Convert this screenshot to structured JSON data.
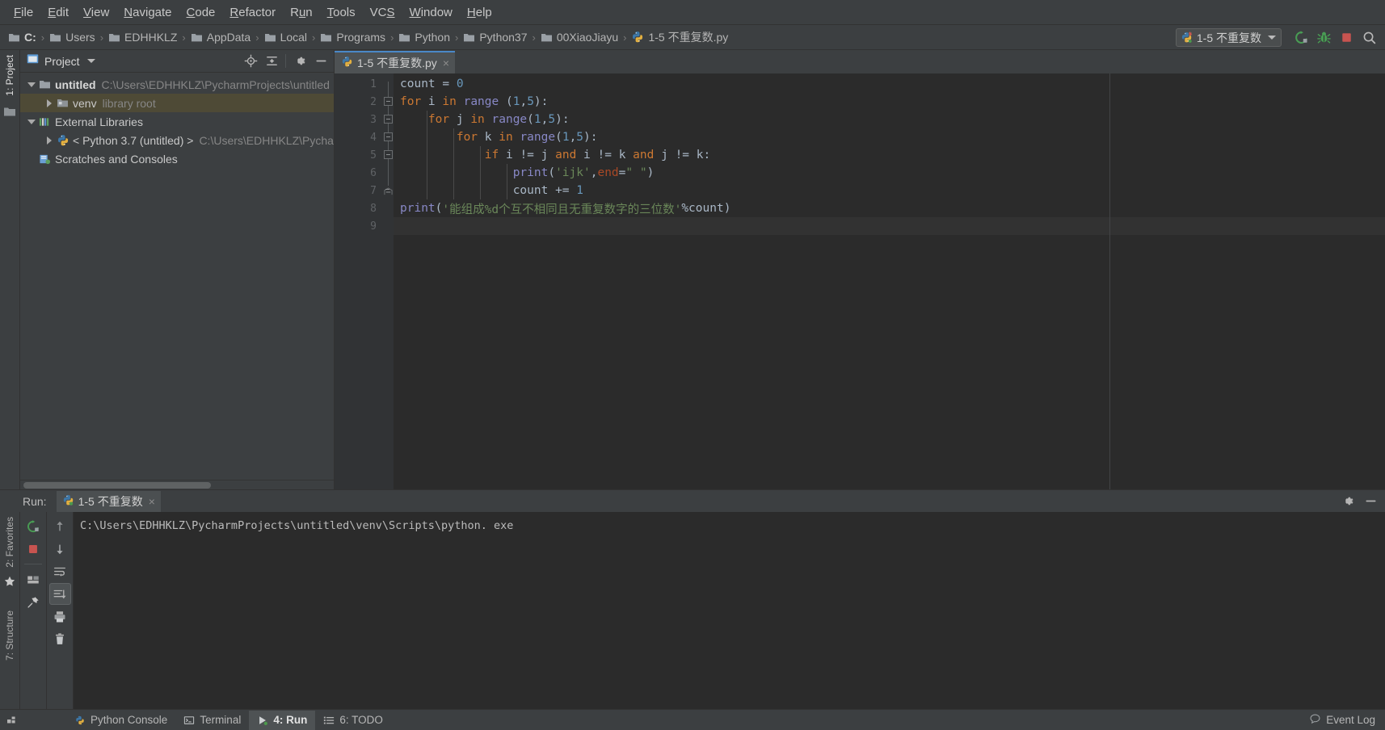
{
  "menu": {
    "items": [
      {
        "label": "File",
        "mnemonic": "F"
      },
      {
        "label": "Edit",
        "mnemonic": "E"
      },
      {
        "label": "View",
        "mnemonic": "V"
      },
      {
        "label": "Navigate",
        "mnemonic": "N"
      },
      {
        "label": "Code",
        "mnemonic": "C"
      },
      {
        "label": "Refactor",
        "mnemonic": "R"
      },
      {
        "label": "Run",
        "mnemonic": "u"
      },
      {
        "label": "Tools",
        "mnemonic": "T"
      },
      {
        "label": "VCS",
        "mnemonic": "S"
      },
      {
        "label": "Window",
        "mnemonic": "W"
      },
      {
        "label": "Help",
        "mnemonic": "H"
      }
    ]
  },
  "navbar": {
    "crumbs": [
      {
        "label": "C:",
        "icon": "folder-icon",
        "bold": true
      },
      {
        "label": "Users",
        "icon": "folder-icon",
        "bold": false
      },
      {
        "label": "EDHHKLZ",
        "icon": "folder-icon",
        "bold": false
      },
      {
        "label": "AppData",
        "icon": "folder-icon",
        "bold": false
      },
      {
        "label": "Local",
        "icon": "folder-icon",
        "bold": false
      },
      {
        "label": "Programs",
        "icon": "folder-icon",
        "bold": false
      },
      {
        "label": "Python",
        "icon": "folder-icon",
        "bold": false
      },
      {
        "label": "Python37",
        "icon": "folder-icon",
        "bold": false
      },
      {
        "label": "00XiaoJiayu",
        "icon": "folder-icon",
        "bold": false
      },
      {
        "label": "1-5 不重复数.py",
        "icon": "python-file-icon",
        "bold": false
      }
    ],
    "separator": "›",
    "run_config": "1-5 不重复数",
    "buttons": [
      {
        "name": "rerun-icon",
        "title": "Rerun"
      },
      {
        "name": "debug-icon",
        "title": "Debug"
      },
      {
        "name": "stop-icon",
        "title": "Stop"
      },
      {
        "name": "search-everywhere-icon",
        "title": "Search Everywhere"
      }
    ]
  },
  "left_strip": {
    "tabs": [
      {
        "label": "1: Project",
        "active": true
      }
    ],
    "bottom_tabs": [
      {
        "label": "2: Favorites",
        "active": false
      },
      {
        "label": "7: Structure",
        "active": false
      }
    ]
  },
  "project_panel": {
    "title": "Project",
    "header_icons": [
      "locate-icon",
      "collapse-all-icon",
      "settings-icon",
      "hide-icon"
    ],
    "tree": [
      {
        "label": "untitled",
        "sub": "C:\\Users\\EDHHKLZ\\PycharmProjects\\untitled",
        "indent": 0,
        "twisty": "down",
        "icon": "folder-icon",
        "bold": true,
        "selected": false
      },
      {
        "label": "venv",
        "sub": "library root",
        "indent": 1,
        "twisty": "right",
        "icon": "venv-folder-icon",
        "bold": false,
        "selected": true
      },
      {
        "label": "External Libraries",
        "sub": "",
        "indent": 0,
        "twisty": "down",
        "icon": "libraries-icon",
        "bold": false,
        "selected": false
      },
      {
        "label": "< Python 3.7 (untitled) >",
        "sub": "C:\\Users\\EDHHKLZ\\Pycharm",
        "indent": 1,
        "twisty": "right",
        "icon": "python-icon",
        "bold": false,
        "selected": false
      },
      {
        "label": "Scratches and Consoles",
        "sub": "",
        "indent": 0,
        "twisty": "none",
        "icon": "scratches-icon",
        "bold": false,
        "selected": false
      }
    ]
  },
  "editor": {
    "tabs": [
      {
        "label": "1-5 不重复数.py",
        "icon": "python-file-icon",
        "active": true,
        "close": "×"
      }
    ],
    "line_numbers": [
      "1",
      "2",
      "3",
      "4",
      "5",
      "6",
      "7",
      "8",
      "9"
    ],
    "code_lines": [
      {
        "num": 1,
        "tokens": [
          {
            "t": "count ",
            "c": "id"
          },
          {
            "t": "= ",
            "c": "par"
          },
          {
            "t": "0",
            "c": "num"
          }
        ],
        "indent": 0
      },
      {
        "num": 2,
        "tokens": [
          {
            "t": "for ",
            "c": "kw"
          },
          {
            "t": "i ",
            "c": "id"
          },
          {
            "t": "in ",
            "c": "kw"
          },
          {
            "t": "range ",
            "c": "bi"
          },
          {
            "t": "(",
            "c": "par"
          },
          {
            "t": "1",
            "c": "num"
          },
          {
            "t": ",",
            "c": "par"
          },
          {
            "t": "5",
            "c": "num"
          },
          {
            "t": "):",
            "c": "par"
          }
        ],
        "indent": 0
      },
      {
        "num": 3,
        "tokens": [
          {
            "t": "    ",
            "c": "id"
          },
          {
            "t": "for ",
            "c": "kw"
          },
          {
            "t": "j ",
            "c": "id"
          },
          {
            "t": "in ",
            "c": "kw"
          },
          {
            "t": "range",
            "c": "bi"
          },
          {
            "t": "(",
            "c": "par"
          },
          {
            "t": "1",
            "c": "num"
          },
          {
            "t": ",",
            "c": "par"
          },
          {
            "t": "5",
            "c": "num"
          },
          {
            "t": "):",
            "c": "par"
          }
        ],
        "indent": 1
      },
      {
        "num": 4,
        "tokens": [
          {
            "t": "        ",
            "c": "id"
          },
          {
            "t": "for ",
            "c": "kw"
          },
          {
            "t": "k ",
            "c": "id"
          },
          {
            "t": "in ",
            "c": "kw"
          },
          {
            "t": "range",
            "c": "bi"
          },
          {
            "t": "(",
            "c": "par"
          },
          {
            "t": "1",
            "c": "num"
          },
          {
            "t": ",",
            "c": "par"
          },
          {
            "t": "5",
            "c": "num"
          },
          {
            "t": "):",
            "c": "par"
          }
        ],
        "indent": 2
      },
      {
        "num": 5,
        "tokens": [
          {
            "t": "            ",
            "c": "id"
          },
          {
            "t": "if ",
            "c": "kw"
          },
          {
            "t": "i ",
            "c": "id"
          },
          {
            "t": "!= ",
            "c": "par"
          },
          {
            "t": "j ",
            "c": "id"
          },
          {
            "t": "and ",
            "c": "kw"
          },
          {
            "t": "i ",
            "c": "id"
          },
          {
            "t": "!= ",
            "c": "par"
          },
          {
            "t": "k ",
            "c": "id"
          },
          {
            "t": "and ",
            "c": "kw"
          },
          {
            "t": "j ",
            "c": "id"
          },
          {
            "t": "!= ",
            "c": "par"
          },
          {
            "t": "k:",
            "c": "id"
          }
        ],
        "indent": 3
      },
      {
        "num": 6,
        "tokens": [
          {
            "t": "                ",
            "c": "id"
          },
          {
            "t": "print",
            "c": "bi"
          },
          {
            "t": "(",
            "c": "par"
          },
          {
            "t": "'ijk'",
            "c": "str"
          },
          {
            "t": ",",
            "c": "par"
          },
          {
            "t": "end",
            "c": "kwarg"
          },
          {
            "t": "=",
            "c": "par"
          },
          {
            "t": "\" \"",
            "c": "str"
          },
          {
            "t": ")",
            "c": "par"
          }
        ],
        "indent": 4
      },
      {
        "num": 7,
        "tokens": [
          {
            "t": "                ",
            "c": "id"
          },
          {
            "t": "count ",
            "c": "id"
          },
          {
            "t": "+= ",
            "c": "par"
          },
          {
            "t": "1",
            "c": "num"
          }
        ],
        "indent": 4
      },
      {
        "num": 8,
        "tokens": [
          {
            "t": "print",
            "c": "bi"
          },
          {
            "t": "(",
            "c": "par"
          },
          {
            "t": "'能组成%d个互不相同且无重复数字的三位数'",
            "c": "str"
          },
          {
            "t": "%count)",
            "c": "par"
          }
        ],
        "indent": 0
      },
      {
        "num": 9,
        "tokens": [],
        "indent": 0
      }
    ]
  },
  "run_window": {
    "label": "Run:",
    "tab_label": "1-5 不重复数",
    "tab_close": "×",
    "tab_icon": "python-run-icon",
    "header_icons": [
      "settings-icon",
      "hide-icon"
    ],
    "toolbar_primary": [
      "rerun-icon",
      "stop-icon",
      "layout-icon",
      "pin-icon"
    ],
    "toolbar_secondary": [
      "up-arrow-icon",
      "down-arrow-icon",
      "soft-wrap-icon",
      "scroll-to-end-icon",
      "print-icon",
      "clear-all-icon"
    ],
    "console_lines": [
      "C:\\Users\\EDHHKLZ\\PycharmProjects\\untitled\\venv\\Scripts\\python. exe"
    ]
  },
  "statusbar": {
    "items": [
      {
        "label": "Python Console",
        "icon": "python-console-icon",
        "active": false
      },
      {
        "label": "Terminal",
        "icon": "terminal-icon",
        "active": false
      },
      {
        "label": "4: Run",
        "icon": "run-triangle-icon",
        "active": true
      },
      {
        "label": "6: TODO",
        "icon": "todo-list-icon",
        "active": false
      }
    ],
    "event_log": "Event Log",
    "event_log_icon": "balloon-icon"
  },
  "colors": {
    "accent_blue": "#4a88c7",
    "selection_olive": "#4e4a36",
    "keyword_orange": "#cc7832",
    "string_green": "#6a8759",
    "number_blue": "#6897bb",
    "builtin_purple": "#8888c6",
    "run_green": "#499C54",
    "stop_red": "#C75450",
    "editor_bg": "#2b2b2b",
    "panel_bg": "#3c3f41"
  }
}
